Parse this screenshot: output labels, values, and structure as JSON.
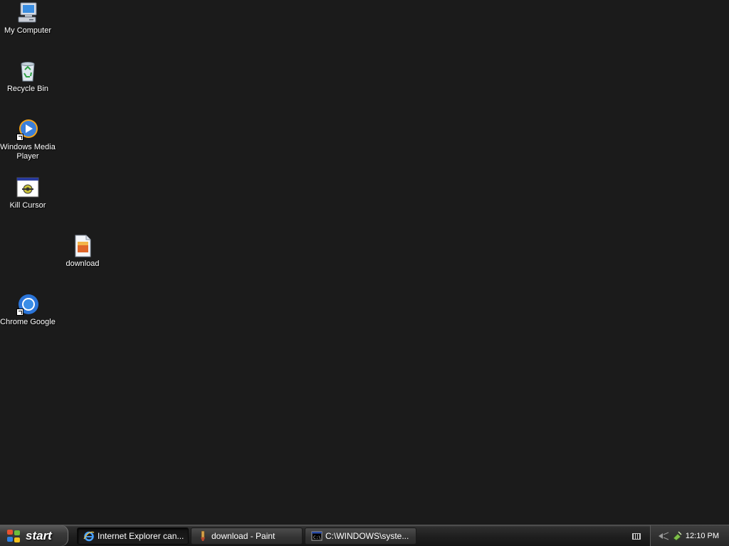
{
  "desktop": {
    "icons": [
      {
        "label": "My Computer",
        "icon": "my-computer-icon"
      },
      {
        "label": "Recycle Bin",
        "icon": "recycle-bin-icon"
      },
      {
        "label": "Windows Media Player",
        "icon": "windows-media-player-icon"
      },
      {
        "label": "Kill Cursor",
        "icon": "kill-cursor-app-icon"
      },
      {
        "label": "download",
        "icon": "image-file-icon"
      },
      {
        "label": "Chrome Google",
        "icon": "chrome-icon"
      }
    ]
  },
  "taskbar": {
    "start_label": "start",
    "tasks": [
      {
        "label": "Internet Explorer can...",
        "icon": "internet-explorer-icon",
        "active": true
      },
      {
        "label": "download - Paint",
        "icon": "paint-icon",
        "active": false
      },
      {
        "label": "C:\\WINDOWS\\syste...",
        "icon": "command-prompt-icon",
        "active": false
      }
    ],
    "tray": {
      "clock": "12:10 PM",
      "icons": [
        "keyboard-icon",
        "network-icon",
        "safely-remove-hardware-icon"
      ]
    }
  }
}
